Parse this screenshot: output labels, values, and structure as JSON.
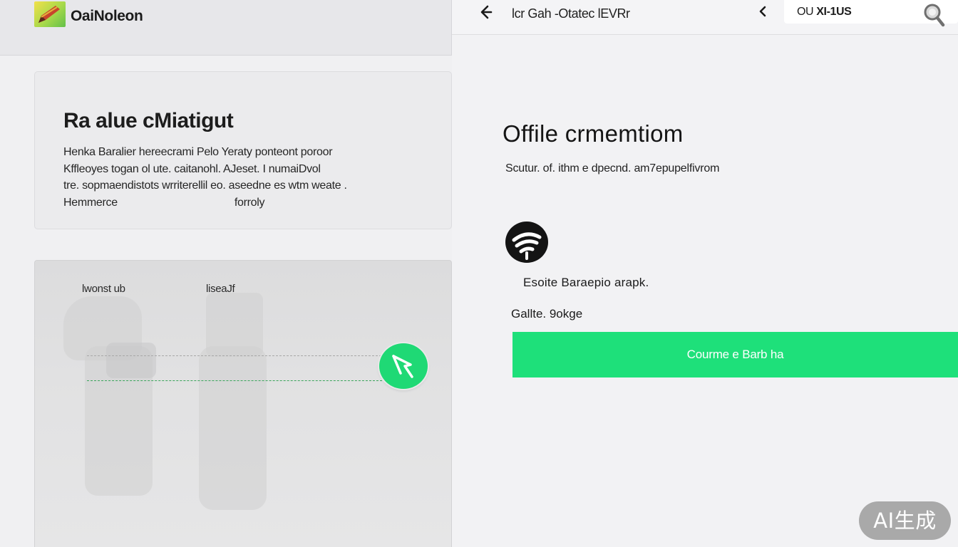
{
  "app": {
    "name": "OaiNoleon",
    "logo_icon": "pencil-logo-icon"
  },
  "info_card": {
    "title": "Ra alue cMiatigut",
    "lines": [
      "Henka Baralier hereecrami Pelo Yeraty ponteont poroor",
      "Kffleoyes togan ol ute. caitanohl.  AJeset. I numaiDvol",
      "tre. sopmaendistots wrriterellil eo.  aseedne es wtm weate .",
      "Hemmerce",
      "forroly"
    ]
  },
  "preview": {
    "label_left": "lwonst ub",
    "label_right": "liseaJf",
    "cursor_icon": "cursor-arrow-icon",
    "accent": "#1fd975"
  },
  "top_bar": {
    "back_icon": "back-arrow-icon",
    "breadcrumb": "lcr Gah -Otatec lEVRr",
    "chevron_icon": "chevron-left-icon",
    "search_prefix": "OU",
    "search_value": "XI-1US",
    "search_icon": "search-icon"
  },
  "main": {
    "title": "Offile crmemtiom",
    "subtitle": "Scutur. of. ithm e dpecnd.  am7epupelfivrom",
    "status_icon": "wifi-icon",
    "status_text": "Esoite Baraepio arapk.",
    "field_label": "Gallte. 9okge",
    "primary_button": "Courme e Barb ha",
    "accent": "#1ee07a"
  },
  "watermark": "AI生成"
}
